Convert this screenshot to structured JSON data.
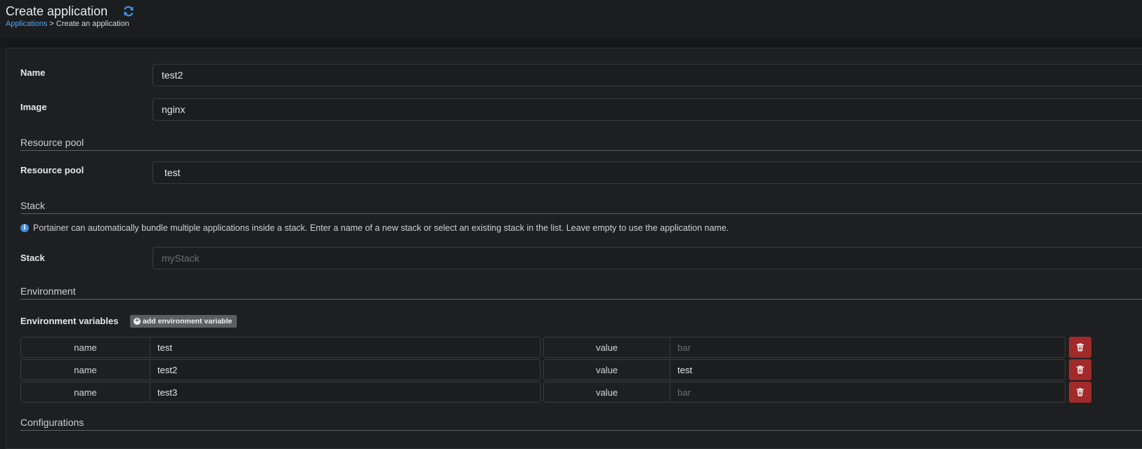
{
  "header": {
    "title": "Create application",
    "breadcrumb": {
      "link": "Applications",
      "separator": " > ",
      "current": "Create an application"
    }
  },
  "form": {
    "name": {
      "label": "Name",
      "value": "test2"
    },
    "image": {
      "label": "Image",
      "value": "nginx"
    },
    "resource_pool_section": "Resource pool",
    "resource_pool": {
      "label": "Resource pool",
      "value": "test"
    },
    "stack_section": "Stack",
    "stack_info": "Portainer can automatically bundle multiple applications inside a stack. Enter a name of a new stack or select an existing stack in the list. Leave empty to use the application name.",
    "stack": {
      "label": "Stack",
      "placeholder": "myStack",
      "value": ""
    },
    "environment_section": "Environment",
    "env_label": "Environment variables",
    "add_env_button": "add environment variable",
    "env_vars": [
      {
        "name_label": "name",
        "name": "test",
        "value_label": "value",
        "value": "",
        "value_placeholder": "bar"
      },
      {
        "name_label": "name",
        "name": "test2",
        "value_label": "value",
        "value": "test",
        "value_placeholder": "bar"
      },
      {
        "name_label": "name",
        "name": "test3",
        "value_label": "value",
        "value": "",
        "value_placeholder": "bar"
      }
    ],
    "configurations_section": "Configurations"
  },
  "colors": {
    "background": "#1c1d1f",
    "link": "#57a5f7",
    "danger": "#a32a2a",
    "info": "#3d8fe0"
  },
  "icons": [
    "refresh-icon",
    "info-icon",
    "plus-circle-icon",
    "trash-icon"
  ]
}
